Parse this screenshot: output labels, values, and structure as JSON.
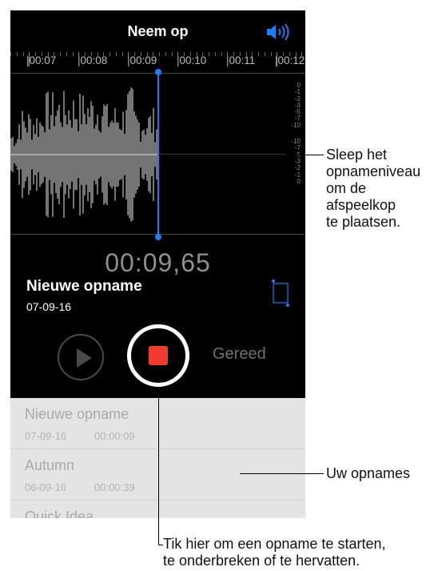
{
  "header": {
    "title": "Neem op",
    "speaker_icon": "speaker-wave-icon"
  },
  "ruler": {
    "labels": [
      "5",
      "|00:07",
      "|00:08",
      "|00:09",
      "|00:10",
      "|00:11",
      "|00:12"
    ]
  },
  "db_scale": [
    "0",
    "-1",
    "-2",
    "-3",
    "-5",
    "-7",
    "-10",
    "",
    "-10",
    "-7",
    "-5",
    "-3",
    "-2",
    "-1",
    "0"
  ],
  "recording": {
    "timer": "00:09,65",
    "title": "Nieuwe opname",
    "date": "07-09-16"
  },
  "controls": {
    "play_icon": "play-icon",
    "record_icon": "record-stop-icon",
    "done_label": "Gereed"
  },
  "recordings": [
    {
      "title": "Nieuwe opname",
      "date": "07-09-16",
      "duration": "00:00:09"
    },
    {
      "title": "Autumn",
      "date": "06-09-16",
      "duration": "00:00:39"
    },
    {
      "title": "Quick Idea",
      "date": "",
      "duration": ""
    }
  ],
  "callouts": {
    "playhead": [
      "Sleep het",
      "opnameniveau",
      "om de",
      "afspeelkop",
      "te plaatsen."
    ],
    "recordings": "Uw opnames",
    "record_button": [
      "Tik hier om een opname te starten,",
      "te onderbreken of te hervatten."
    ]
  },
  "colors": {
    "accent": "#1e7cf2",
    "record": "#f13a30",
    "background": "#000000",
    "list_bg": "#e4e4e4"
  }
}
